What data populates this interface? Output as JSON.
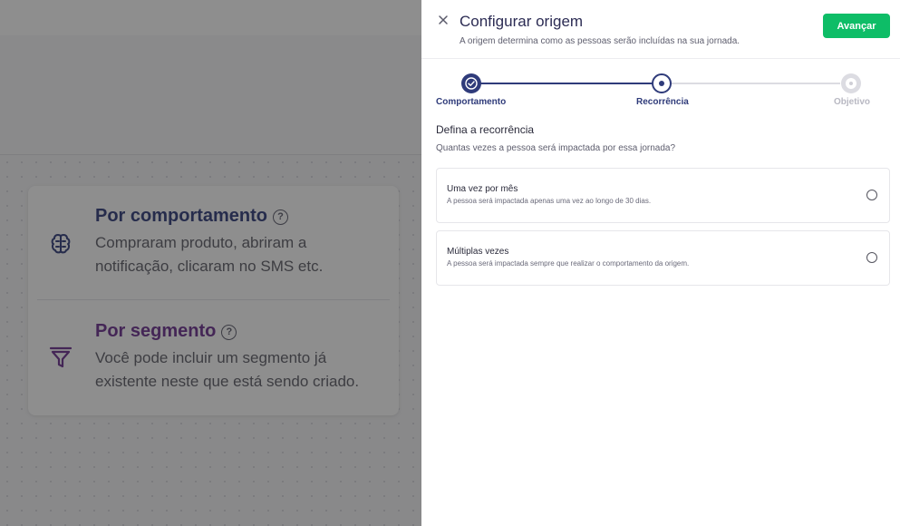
{
  "background": {
    "options": [
      {
        "title": "Por comportamento",
        "description": "Compraram produto, abriram a notificação, clicaram no SMS etc.",
        "icon": "brain-icon",
        "color": "#2f3b7a"
      },
      {
        "title": "Por segmento",
        "description": "Você pode incluir um segmento já existente neste que está sendo criado.",
        "icon": "funnel-icon",
        "color": "#6b2f8f"
      }
    ],
    "help_glyph": "?"
  },
  "drawer": {
    "title": "Configurar origem",
    "subtitle": "A origem determina como as pessoas serão incluídas na sua jornada.",
    "next_label": "Avançar",
    "stepper": {
      "steps": [
        {
          "label": "Comportamento",
          "state": "done"
        },
        {
          "label": "Recorrência",
          "state": "current"
        },
        {
          "label": "Objetivo",
          "state": "todo"
        }
      ]
    },
    "section_title": "Defina a recorrência",
    "section_subtitle": "Quantas vezes a pessoa será impactada por essa jornada?",
    "options": [
      {
        "title": "Uma vez por mês",
        "description": "A pessoa será impactada apenas uma vez ao longo de 30 dias.",
        "selected": false
      },
      {
        "title": "Múltiplas vezes",
        "description": "A pessoa será impactada sempre que realizar o comportamento da origem.",
        "selected": false
      }
    ]
  },
  "colors": {
    "primary": "#2f3b7a",
    "accent_green": "#0ebd67",
    "inactive": "#dcdce2"
  }
}
